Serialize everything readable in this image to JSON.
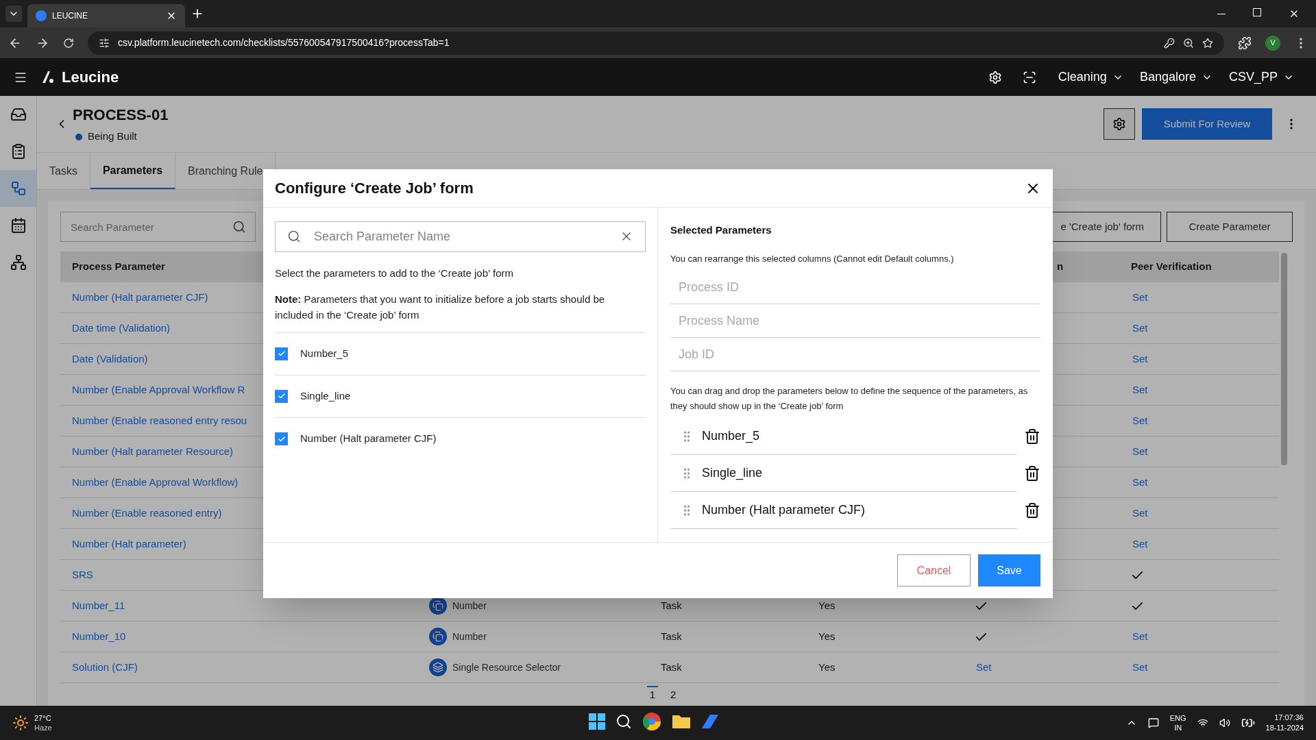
{
  "browser": {
    "tab_title": "LEUCINE",
    "url": "csv.platform.leucinetech.com/checklists/557600547917500416?processTab=1",
    "profile_initial": "V"
  },
  "header": {
    "app_name": "Leucine",
    "selectors": [
      {
        "label": "Cleaning"
      },
      {
        "label": "Bangalore"
      },
      {
        "label": "CSV_PP"
      }
    ]
  },
  "sidebar": {
    "items": [
      {
        "kind": "inbox",
        "selected": false
      },
      {
        "kind": "clipboard",
        "selected": false
      },
      {
        "kind": "workflow",
        "selected": true
      },
      {
        "kind": "calendar",
        "selected": false
      },
      {
        "kind": "network",
        "selected": false
      }
    ]
  },
  "page": {
    "title": "PROCESS-01",
    "status": "Being Built",
    "primary_button": "Submit For Review"
  },
  "tabs": [
    {
      "label": "Tasks",
      "selected": false
    },
    {
      "label": "Parameters",
      "selected": true
    },
    {
      "label": "Branching Rule",
      "selected": false
    }
  ],
  "toolbar": {
    "search_placeholder": "Search Parameter",
    "buttons": [
      "e 'Create job' form",
      "Create Parameter"
    ]
  },
  "table": {
    "columns": {
      "process_parameter": "Process Parameter",
      "column_5": "n",
      "peer_verification": "Peer Verification"
    },
    "rows": [
      {
        "process_parameter": "Number (Halt parameter CJF)",
        "peer_verification": {
          "kind": "link",
          "text": "Set"
        }
      },
      {
        "process_parameter": "Date time (Validation)",
        "peer_verification": {
          "kind": "link",
          "text": "Set"
        }
      },
      {
        "process_parameter": "Date (Validation)",
        "peer_verification": {
          "kind": "link",
          "text": "Set"
        }
      },
      {
        "process_parameter": "Number (Enable Approval Workflow R",
        "peer_verification": {
          "kind": "link",
          "text": "Set"
        }
      },
      {
        "process_parameter": "Number (Enable reasoned entry resou",
        "peer_verification": {
          "kind": "link",
          "text": "Set"
        }
      },
      {
        "process_parameter": "Number (Halt parameter Resource)",
        "peer_verification": {
          "kind": "link",
          "text": "Set"
        }
      },
      {
        "process_parameter": "Number (Enable Approval Workflow)",
        "peer_verification": {
          "kind": "link",
          "text": "Set"
        }
      },
      {
        "process_parameter": "Number (Enable reasoned entry)",
        "peer_verification": {
          "kind": "link",
          "text": "Set"
        }
      },
      {
        "process_parameter": "Number (Halt parameter)",
        "peer_verification": {
          "kind": "link",
          "text": "Set"
        }
      },
      {
        "process_parameter": "SRS",
        "peer_verification": {
          "kind": "check"
        }
      },
      {
        "process_parameter": "Number_11",
        "column_2": {
          "kind": "number",
          "text": "Number"
        },
        "column_3": "Task",
        "column_4": "Yes",
        "column_5": {
          "kind": "check"
        },
        "peer_verification": {
          "kind": "check"
        }
      },
      {
        "process_parameter": "Number_10",
        "column_2": {
          "kind": "number",
          "text": "Number"
        },
        "column_3": "Task",
        "column_4": "Yes",
        "column_5": {
          "kind": "check"
        },
        "peer_verification": {
          "kind": "link",
          "text": "Set"
        }
      },
      {
        "process_parameter": "Solution (CJF)",
        "column_2": {
          "kind": "resource",
          "text": "Single Resource Selector"
        },
        "column_3": "Task",
        "column_4": "Yes",
        "column_5": {
          "kind": "link",
          "text": "Set"
        },
        "peer_verification": {
          "kind": "link",
          "text": "Set"
        }
      }
    ]
  },
  "pagination": [
    {
      "label": "1",
      "selected": true
    },
    {
      "label": "2",
      "selected": false
    }
  ],
  "modal": {
    "title": "Configure ‘Create Job’ form",
    "search_placeholder": "Search Parameter Name",
    "instruction": "Select the parameters to add to the ‘Create job’ form",
    "note": "**Note:** Parameters that you want to initialize before a job starts should be included in the ‘Create job’ form",
    "options": [
      {
        "label": "Number_5",
        "checked": true
      },
      {
        "label": "Single_line",
        "checked": true
      },
      {
        "label": "Number (Halt parameter CJF)",
        "checked": true
      }
    ],
    "selected_heading": "Selected Parameters",
    "rearrange_hint": "You can rearrange this selected columns (Cannot edit Default columns.)",
    "default_fields": [
      "Process ID",
      "Process Name",
      "Job ID"
    ],
    "drag_hint": "You can drag and drop the parameters below to define the sequence of the parameters, as they should show up in the ‘Create job’ form",
    "selected_items": [
      "Number_5",
      "Single_line",
      "Number (Halt parameter CJF)"
    ],
    "cancel": "Cancel",
    "save": "Save"
  },
  "taskbar": {
    "temperature": "27°C",
    "weather": "Haze",
    "language": "ENG",
    "region": "IN",
    "time": "17:07:36",
    "date": "18-11-2024"
  }
}
